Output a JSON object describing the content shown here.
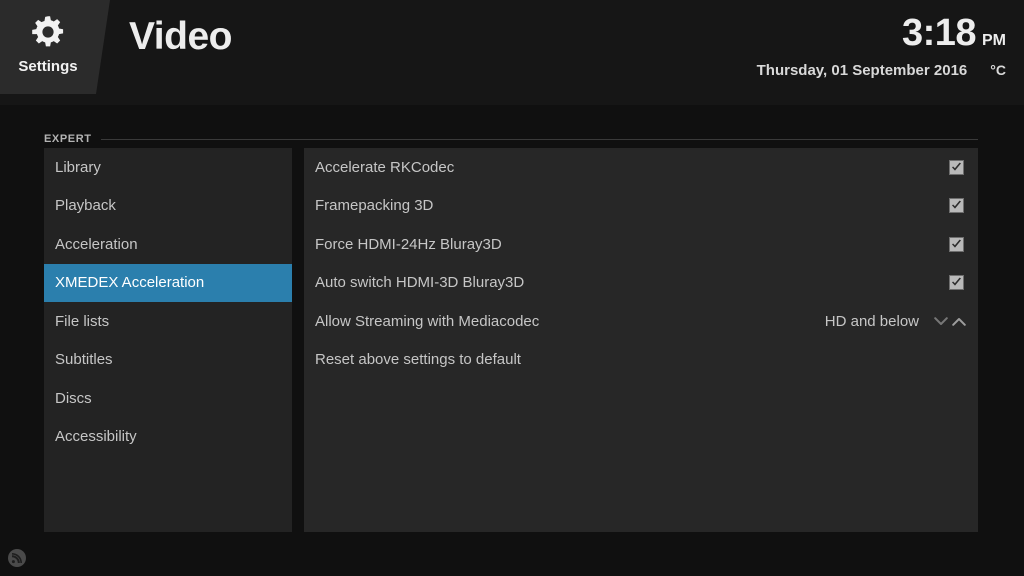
{
  "header": {
    "badge_label": "Settings",
    "badge_icon": "gear-icon",
    "page_title": "Video",
    "clock": {
      "time": "3:18",
      "ampm": "PM",
      "date": "Thursday, 01 September 2016",
      "temperature_unit": "°C"
    }
  },
  "category": {
    "label": "EXPERT"
  },
  "sidebar": {
    "selected_index": 3,
    "items": [
      {
        "label": "Library"
      },
      {
        "label": "Playback"
      },
      {
        "label": "Acceleration"
      },
      {
        "label": "XMEDEX Acceleration"
      },
      {
        "label": "File lists"
      },
      {
        "label": "Subtitles"
      },
      {
        "label": "Discs"
      },
      {
        "label": "Accessibility"
      }
    ]
  },
  "settings": {
    "rows": [
      {
        "label": "Accelerate RKCodec",
        "control": "checkbox",
        "checked": true
      },
      {
        "label": "Framepacking 3D",
        "control": "checkbox",
        "checked": true
      },
      {
        "label": "Force HDMI-24Hz Bluray3D",
        "control": "checkbox",
        "checked": true
      },
      {
        "label": "Auto switch HDMI-3D Bluray3D",
        "control": "checkbox",
        "checked": true
      },
      {
        "label": "Allow Streaming with Mediacodec",
        "control": "spinner",
        "value": "HD and below"
      },
      {
        "label": "Reset above settings to default",
        "control": "none"
      }
    ]
  },
  "footer": {
    "rss_icon": "rss-icon"
  },
  "colors": {
    "background": "#101010",
    "header_background": "#161616",
    "badge_background": "#2b2b2b",
    "sidebar_background": "#232323",
    "panel_background": "#272727",
    "highlight": "#2b7fad",
    "text": "#c6c6c6",
    "text_bright": "#ededed",
    "checkbox_fill": "#b9b9b9"
  }
}
